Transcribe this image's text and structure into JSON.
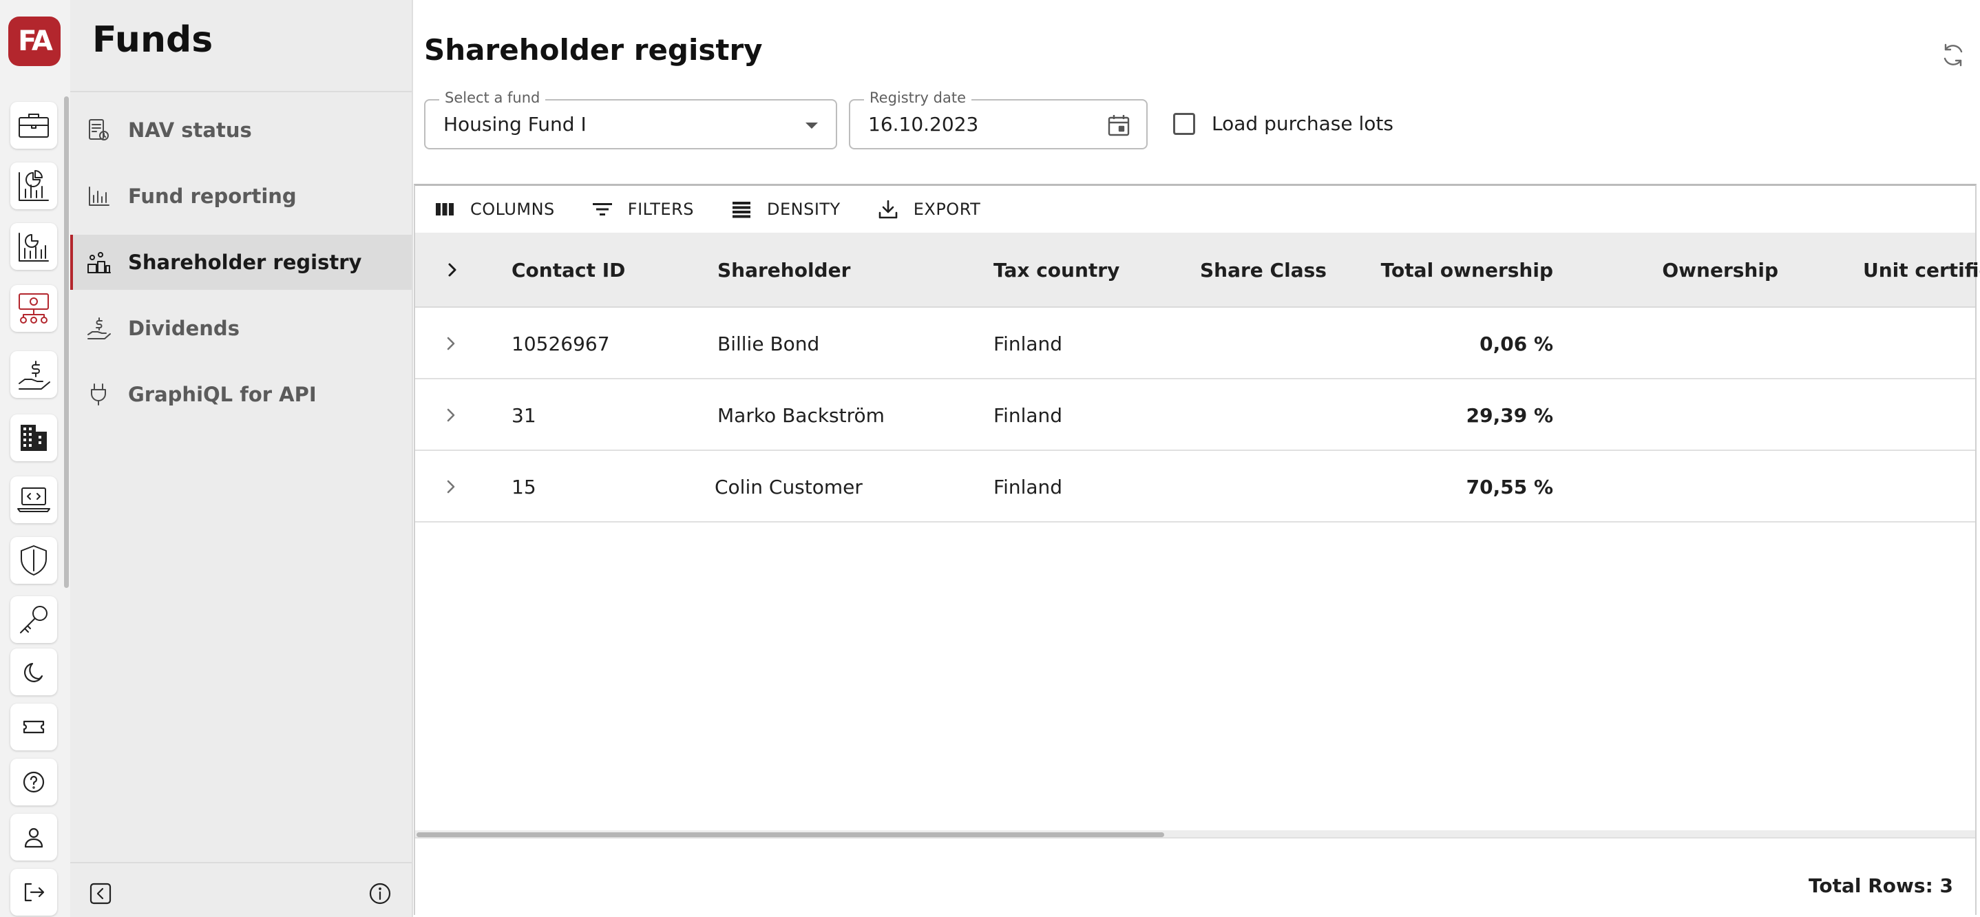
{
  "app": {
    "logo_text": "FA",
    "brand_color": "#b3262d"
  },
  "rail": {
    "icons": [
      "briefcase-icon",
      "pie-chart-report-icon",
      "bar-chart-report-icon",
      "funds-network-icon",
      "hand-money-icon",
      "building-icon",
      "laptop-code-icon",
      "shield-icon",
      "key-icon",
      "moon-icon",
      "ticket-icon",
      "help-icon",
      "user-icon",
      "logout-icon"
    ],
    "active": "funds-network-icon"
  },
  "nav": {
    "title": "Funds",
    "items": [
      {
        "label": "NAV status",
        "icon": "report-icon"
      },
      {
        "label": "Fund reporting",
        "icon": "bar-chart-icon"
      },
      {
        "label": "Shareholder registry",
        "icon": "people-chart-icon",
        "active": true
      },
      {
        "label": "Dividends",
        "icon": "hand-dollar-icon"
      },
      {
        "label": "GraphiQL for API",
        "icon": "plug-icon"
      }
    ]
  },
  "main": {
    "title": "Shareholder registry",
    "fund_select": {
      "label": "Select a fund",
      "value": "Housing Fund I"
    },
    "registry_date": {
      "label": "Registry date",
      "value": "16.10.2023"
    },
    "load_purchase_lots": {
      "label": "Load purchase lots",
      "checked": false
    },
    "toolbar": {
      "columns": "COLUMNS",
      "filters": "FILTERS",
      "density": "DENSITY",
      "export": "EXPORT"
    },
    "columns": [
      "Contact ID",
      "Shareholder",
      "Tax country",
      "Share Class",
      "Total ownership",
      "Ownership",
      "Unit certifica"
    ],
    "rows": [
      {
        "contact_id": "10526967",
        "shareholder": "Billie Bond",
        "tax_country": "Finland",
        "share_class": "",
        "total_ownership": "0,06 %",
        "ownership": ""
      },
      {
        "contact_id": "31",
        "shareholder": "Marko Backström",
        "tax_country": "Finland",
        "share_class": "",
        "total_ownership": "29,39 %",
        "ownership": ""
      },
      {
        "contact_id": "15",
        "shareholder": "Colin Customer",
        "tax_country": "Finland",
        "share_class": "",
        "total_ownership": "70,55 %",
        "ownership": ""
      }
    ],
    "total_rows": "Total Rows: 3"
  }
}
